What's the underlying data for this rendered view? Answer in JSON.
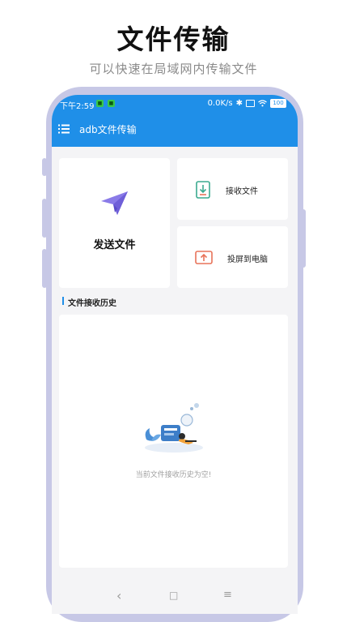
{
  "promo": {
    "title": "文件传输",
    "subtitle": "可以快速在局域网内传输文件"
  },
  "status_bar": {
    "time": "下午2:59",
    "network_speed": "0.0K/s",
    "battery_level": "100",
    "icons": [
      "notification-icon",
      "notification-icon",
      "bluetooth-icon",
      "sim-icon",
      "wifi-icon",
      "battery-icon"
    ]
  },
  "app_bar": {
    "title": "adb文件传输",
    "menu_icon": "menu-icon"
  },
  "actions": {
    "send_label": "发送文件",
    "receive_label": "接收文件",
    "cast_label": "投屏到电脑"
  },
  "history": {
    "section_title": "文件接收历史",
    "empty_text": "当前文件接收历史为空!"
  },
  "nav_bar": {
    "back": "‹",
    "home": "□",
    "recent": "≡"
  },
  "colors": {
    "accent": "#1f8fe8",
    "frame": "#c7c8e6",
    "background": "#f4f4f6",
    "send_icon": "#8a7be8",
    "receive_icon": "#3aaa8f",
    "cast_icon": "#e8735a"
  }
}
